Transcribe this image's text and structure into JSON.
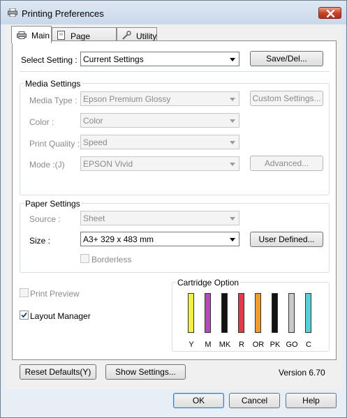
{
  "window": {
    "title": "Printing Preferences"
  },
  "tabs": [
    {
      "label": "Main"
    },
    {
      "label": "Page Layout"
    },
    {
      "label": "Utility"
    }
  ],
  "select_setting": {
    "label": "Select Setting :",
    "value": "Current Settings",
    "button": "Save/Del..."
  },
  "media_settings": {
    "title": "Media Settings",
    "media_type": {
      "label": "Media Type :",
      "value": "Epson Premium Glossy"
    },
    "custom_button": "Custom Settings...",
    "color": {
      "label": "Color :",
      "value": "Color"
    },
    "print_quality": {
      "label": "Print Quality :",
      "value": "Speed"
    },
    "mode": {
      "label": "Mode :(J)",
      "value": "EPSON Vivid"
    },
    "advanced_button": "Advanced..."
  },
  "paper_settings": {
    "title": "Paper Settings",
    "source": {
      "label": "Source :",
      "value": "Sheet"
    },
    "size": {
      "label": "Size :",
      "value": "A3+ 329 x 483 mm"
    },
    "user_defined_button": "User Defined...",
    "borderless": {
      "label": "Borderless",
      "checked": false
    }
  },
  "print_preview": {
    "label": "Print Preview",
    "checked": false
  },
  "layout_manager": {
    "label": "Layout Manager",
    "checked": true
  },
  "cartridge": {
    "title": "Cartridge Option",
    "inks": [
      {
        "name": "Y",
        "color": "#f2ee4a"
      },
      {
        "name": "M",
        "color": "#b04bb8"
      },
      {
        "name": "MK",
        "color": "#111111"
      },
      {
        "name": "R",
        "color": "#e33a4a"
      },
      {
        "name": "OR",
        "color": "#f39a2e"
      },
      {
        "name": "PK",
        "color": "#111111"
      },
      {
        "name": "GO",
        "color": "#c9c9c9"
      },
      {
        "name": "C",
        "color": "#5ad0d6"
      }
    ]
  },
  "bottom": {
    "reset_button": "Reset Defaults(Y)",
    "show_settings_button": "Show Settings...",
    "version": "Version 6.70"
  },
  "dialog": {
    "ok": "OK",
    "cancel": "Cancel",
    "help": "Help"
  }
}
